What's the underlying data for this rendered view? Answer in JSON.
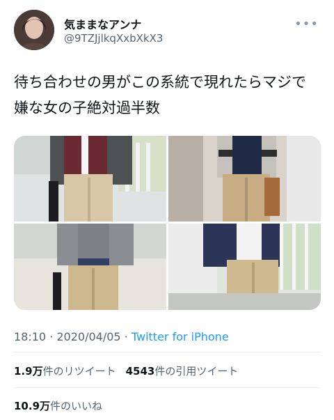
{
  "user": {
    "display_name": "気ままなアンナ",
    "handle": "@9TZJjlkqXxbXkX3"
  },
  "tweet": {
    "text": "待ち合わせの男がこの系統で現れたらマジで嫌な女の子絶対過半数"
  },
  "meta": {
    "time": "18:10",
    "separator": " · ",
    "date": "2020/04/05",
    "source": "Twitter for iPhone"
  },
  "stats": {
    "retweets_count": "1.9万",
    "retweets_label": "件のリツイート",
    "quotes_count": "4543",
    "quotes_label": "件の引用ツイート",
    "likes_count": "10.9万",
    "likes_label": "件のいいね"
  },
  "icons": {
    "more": "more-icon"
  },
  "colors": {
    "link": "#1d9bf0",
    "muted": "#536471",
    "text": "#0f1419"
  }
}
